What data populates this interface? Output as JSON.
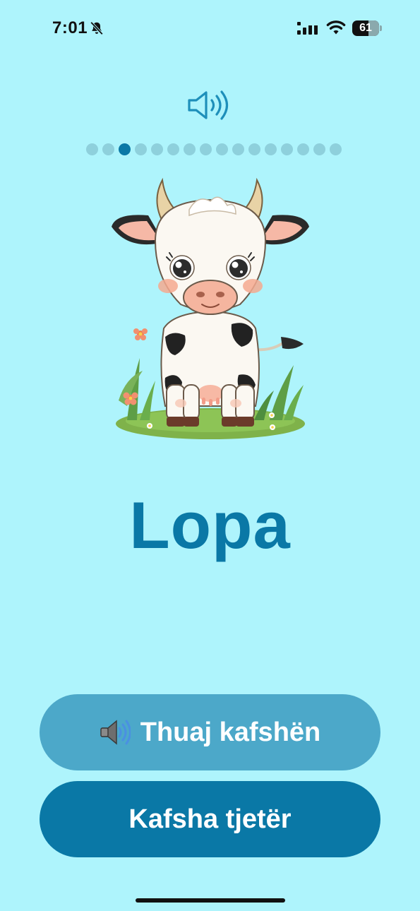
{
  "status_bar": {
    "time": "7:01",
    "battery_percent": "61",
    "battery_level": 0.61,
    "icons": [
      "bell-off-icon",
      "signal-icon",
      "wifi-icon",
      "battery-icon"
    ]
  },
  "header": {
    "sound_icon": "speaker-icon"
  },
  "progress": {
    "total": 16,
    "current": 3
  },
  "card": {
    "image": "cow-illustration",
    "name": "Lopa"
  },
  "actions": {
    "say_animal_label": "Thuaj kafshën",
    "say_animal_icon": "speaker-emoji-icon",
    "next_animal_label": "Kafsha tjetër"
  },
  "colors": {
    "background": "#AEF4FC",
    "accent": "#0A78A6",
    "secondary_button": "#4CA8C9",
    "dot_inactive": "#8ED0DC"
  }
}
